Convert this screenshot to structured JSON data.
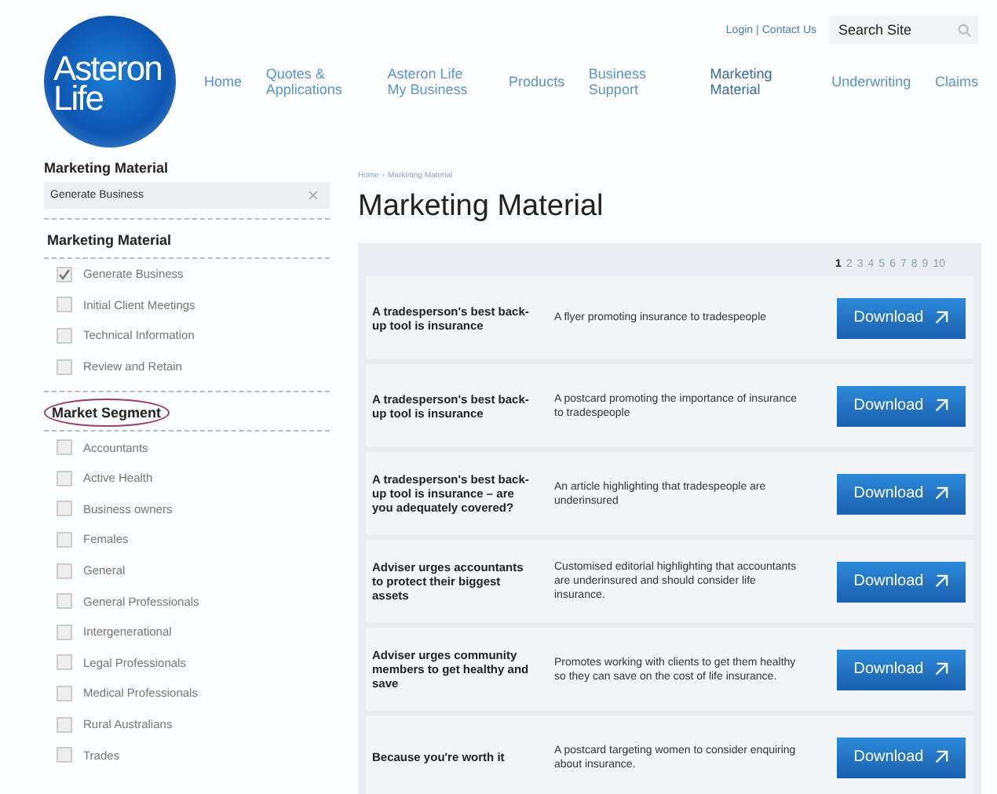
{
  "header": {
    "logo": "Asteron Life",
    "top_links": [
      "Login",
      "Contact Us"
    ],
    "top_separator": "|",
    "search": {
      "placeholder": "Search Site"
    },
    "nav": [
      {
        "label": "Home",
        "selected": false
      },
      {
        "label": "Quotes & Applications",
        "selected": false
      },
      {
        "label": "Asteron Life My Business",
        "selected": false
      },
      {
        "label": "Products",
        "selected": false
      },
      {
        "label": "Business Support",
        "selected": false
      },
      {
        "label": "Marketing Material",
        "selected": true
      },
      {
        "label": "Underwriting",
        "selected": false
      },
      {
        "label": "Claims",
        "selected": false
      }
    ]
  },
  "sidebar": {
    "title": "Marketing Material",
    "active_filter": "Generate Business",
    "groups": [
      {
        "heading": "Marketing Material",
        "circled": false,
        "items": [
          {
            "label": "Generate Business",
            "checked": true
          },
          {
            "label": "Initial Client Meetings",
            "checked": false
          },
          {
            "label": "Technical Information",
            "checked": false
          },
          {
            "label": "Review and Retain",
            "checked": false
          }
        ]
      },
      {
        "heading": "Market Segment",
        "circled": true,
        "items": [
          {
            "label": "Accountants",
            "checked": false
          },
          {
            "label": "Active Health",
            "checked": false
          },
          {
            "label": "Business owners",
            "checked": false
          },
          {
            "label": "Females",
            "checked": false
          },
          {
            "label": "General",
            "checked": false
          },
          {
            "label": "General Professionals",
            "checked": false
          },
          {
            "label": "Intergenerational",
            "checked": false
          },
          {
            "label": "Legal Professionals",
            "checked": false
          },
          {
            "label": "Medical Professionals",
            "checked": false
          },
          {
            "label": "Rural Australians",
            "checked": false
          },
          {
            "label": "Trades",
            "checked": false
          }
        ]
      }
    ]
  },
  "content": {
    "breadcrumb": [
      "Home",
      "Marketing Material"
    ],
    "breadcrumb_separator": "›",
    "title": "Marketing Material",
    "pages": [
      {
        "label": "1",
        "selected": true
      },
      {
        "label": "2",
        "selected": false
      },
      {
        "label": "3",
        "selected": false
      },
      {
        "label": "4",
        "selected": false
      },
      {
        "label": "5",
        "selected": false
      },
      {
        "label": "6",
        "selected": false
      },
      {
        "label": "7",
        "selected": false
      },
      {
        "label": "8",
        "selected": false
      },
      {
        "label": "9",
        "selected": false
      },
      {
        "label": "10",
        "selected": false
      }
    ],
    "rows": [
      {
        "title": "A tradesperson's best back-up tool is insurance",
        "description": "A flyer promoting insurance to tradespeople",
        "button": "Download"
      },
      {
        "title": "A tradesperson's best back-up tool is insurance",
        "description": "A postcard promoting the importance of insurance to tradespeople",
        "button": "Download"
      },
      {
        "title": "A tradesperson's best back-up tool is insurance – are you adequately covered?",
        "description": "An article highlighting that tradespeople are underinsured",
        "button": "Download"
      },
      {
        "title": "Adviser urges accountants to protect their biggest assets",
        "description": "Customised editorial highlighting that accountants are underinsured and should consider life insurance.",
        "button": "Download"
      },
      {
        "title": "Adviser urges community members to get healthy and save",
        "description": "Promotes working with clients to get them healthy so they can save on the cost of life insurance.",
        "button": "Download"
      },
      {
        "title": "Because you're worth it",
        "description": "A postcard targeting women to consider enquiring about insurance.",
        "button": "Download"
      }
    ]
  }
}
